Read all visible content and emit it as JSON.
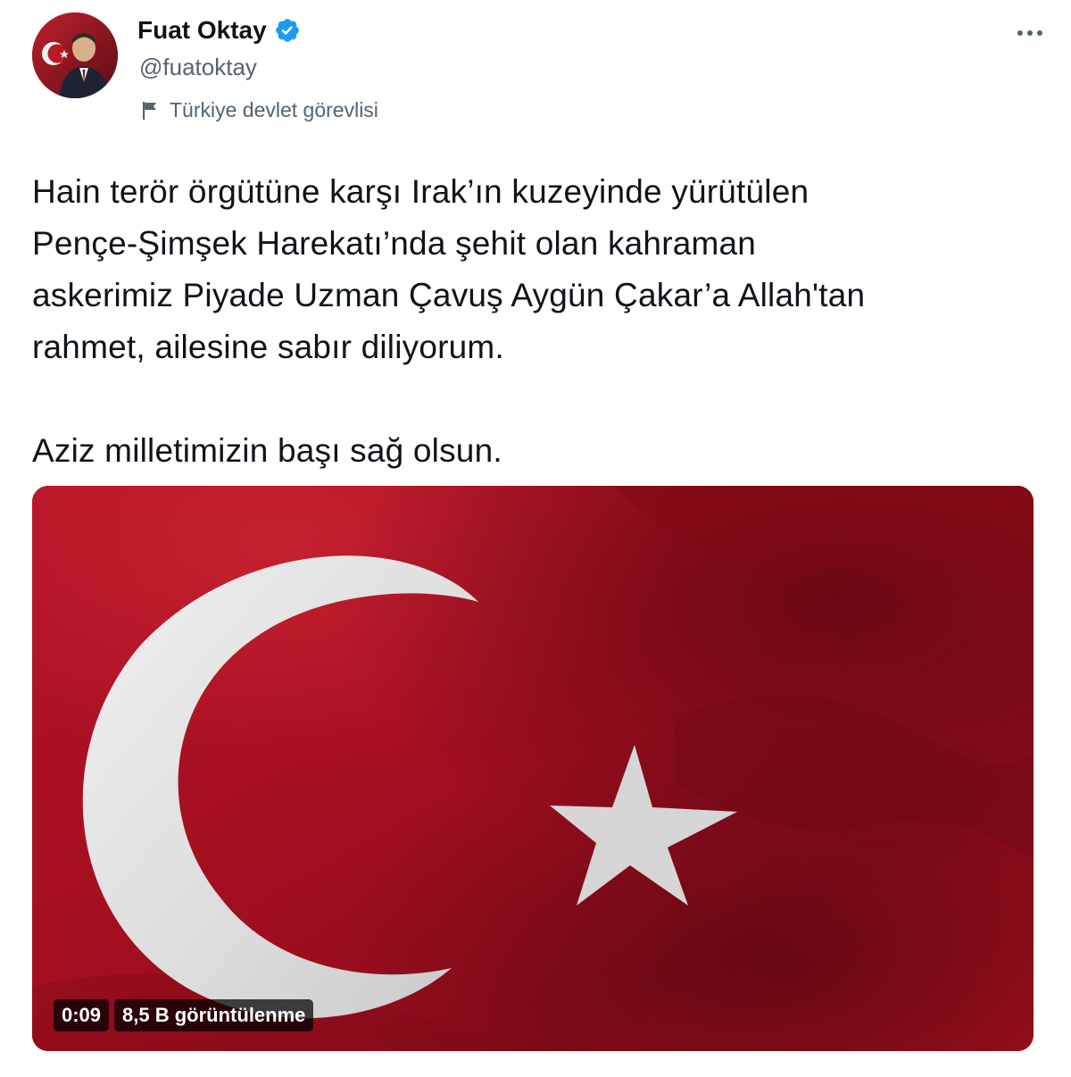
{
  "author": {
    "name": "Fuat Oktay",
    "handle": "@fuatoktay",
    "verified": true,
    "affiliation_label": "Türkiye devlet görevlisi"
  },
  "tweet": {
    "text_paragraph_1": "Hain terör örgütüne karşı Irak’ın kuzeyinde yürütülen\nPençe-Şimşek Harekatı’nda şehit olan kahraman\naskerimiz Piyade Uzman Çavuş Aygün Çakar’a Allah'tan\nrahmet, ailesine sabır diliyorum.",
    "text_paragraph_2": "Aziz milletimizin başı sağ olsun."
  },
  "media": {
    "type": "video",
    "duration": "0:09",
    "views": "8,5 B görüntülenme"
  },
  "icons": {
    "more": "more-horizontal-icon",
    "verified": "verified-badge-icon",
    "affiliation": "flag-icon"
  },
  "colors": {
    "text": "#0f1419",
    "secondary_text": "#536471",
    "verified_blue": "#1d9bf0",
    "flag_red": "#b5121f",
    "flag_white": "#f2f2f2"
  }
}
